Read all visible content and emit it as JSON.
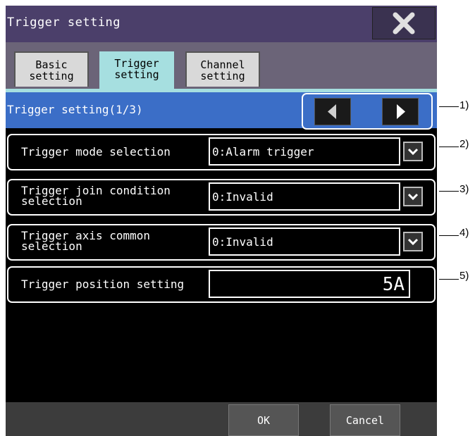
{
  "window": {
    "title": "Trigger setting"
  },
  "tabs": [
    {
      "line1": "Basic",
      "line2": "setting",
      "active": false
    },
    {
      "line1": "Trigger",
      "line2": "setting",
      "active": true
    },
    {
      "line1": "Channel",
      "line2": "setting",
      "active": false
    }
  ],
  "section": {
    "title": "Trigger setting(1/3)"
  },
  "rows": [
    {
      "label_line1": "Trigger mode selection",
      "label_line2": "",
      "value": "0:Alarm trigger"
    },
    {
      "label_line1": "Trigger join condition",
      "label_line2": "selection",
      "value": "0:Invalid"
    },
    {
      "label_line1": "Trigger axis common",
      "label_line2": "selection",
      "value": "0:Invalid"
    },
    {
      "label_line1": "Trigger position setting",
      "label_line2": "",
      "value": "5A"
    }
  ],
  "footer": {
    "ok": "OK",
    "cancel": "Cancel"
  },
  "callouts": [
    "1)",
    "2)",
    "3)",
    "4)",
    "5)"
  ],
  "icons": {
    "close": "close-icon",
    "prev": "triangle-left-icon",
    "next": "triangle-right-icon",
    "dropdown": "chevron-down-icon"
  },
  "colors": {
    "titlebar": "#4b3f6a",
    "tabbar": "#6b6478",
    "active_tab": "#a6dfe0",
    "section_bar": "#3b6ec7"
  }
}
